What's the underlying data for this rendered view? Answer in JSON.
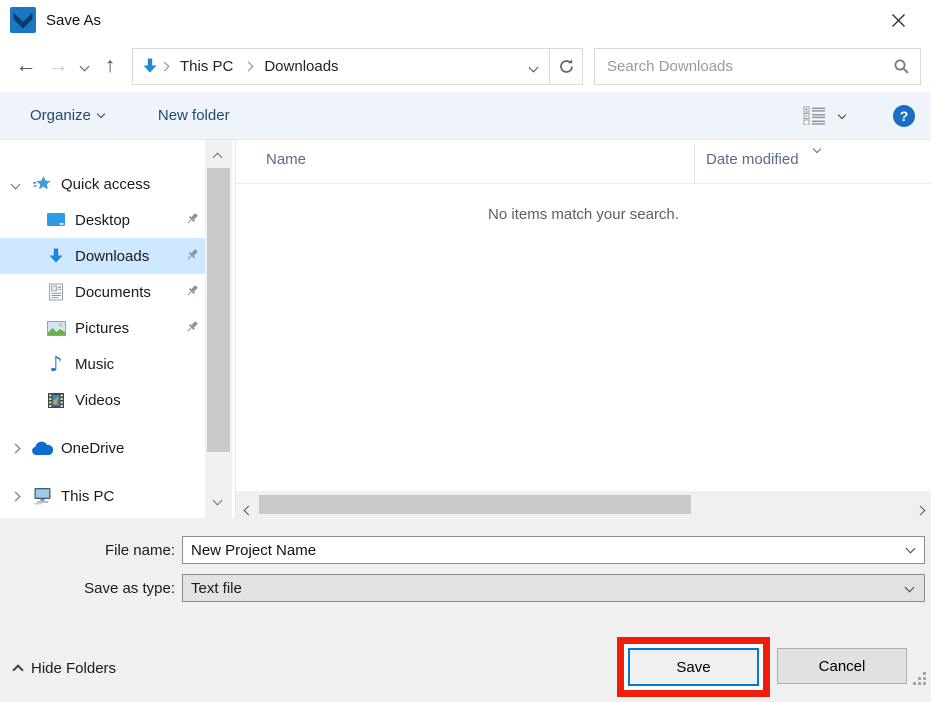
{
  "window": {
    "title": "Save As"
  },
  "nav": {
    "breadcrumb": {
      "root": "This PC",
      "current": "Downloads"
    },
    "search": {
      "placeholder": "Search Downloads"
    }
  },
  "toolbar": {
    "organize_label": "Organize",
    "new_folder_label": "New folder",
    "help_glyph": "?"
  },
  "sidebar": {
    "items": [
      {
        "label": "Quick access"
      },
      {
        "label": "Desktop",
        "pinned": true
      },
      {
        "label": "Downloads",
        "pinned": true,
        "selected": true
      },
      {
        "label": "Documents",
        "pinned": true
      },
      {
        "label": "Pictures",
        "pinned": true
      },
      {
        "label": "Music"
      },
      {
        "label": "Videos"
      },
      {
        "label": "OneDrive"
      },
      {
        "label": "This PC"
      }
    ]
  },
  "filelist": {
    "columns": [
      "Name",
      "Date modified"
    ],
    "empty_message": "No items match your search."
  },
  "form": {
    "file_name_label": "File name:",
    "file_name_value": "New Project Name",
    "save_type_label": "Save as type:",
    "save_type_value": "Text file"
  },
  "footer": {
    "hide_folders_label": "Hide Folders",
    "save_label": "Save",
    "cancel_label": "Cancel"
  },
  "icons": {
    "app": "blue-square-chevron-logo",
    "location": "blue-download-arrow",
    "search": "magnifier",
    "refresh": "circular-arrow",
    "help": "question-mark-circle",
    "view_mode": "details-list",
    "quick_access": "star",
    "desktop": "blue-monitor",
    "downloads": "blue-download-arrow",
    "documents": "document-page",
    "pictures": "landscape-photo",
    "music": "eighth-note",
    "videos": "film-strip",
    "onedrive": "cloud",
    "this_pc": "computer-monitor",
    "pin": "pushpin"
  },
  "colors": {
    "accent": "#0078d7",
    "annotation_red": "#ee1d0c",
    "selection_blue": "#cde8ff",
    "toolbar_bg": "#eff4fa",
    "toolbar_text": "#26486e",
    "panel_bg": "#f0f0f0"
  }
}
